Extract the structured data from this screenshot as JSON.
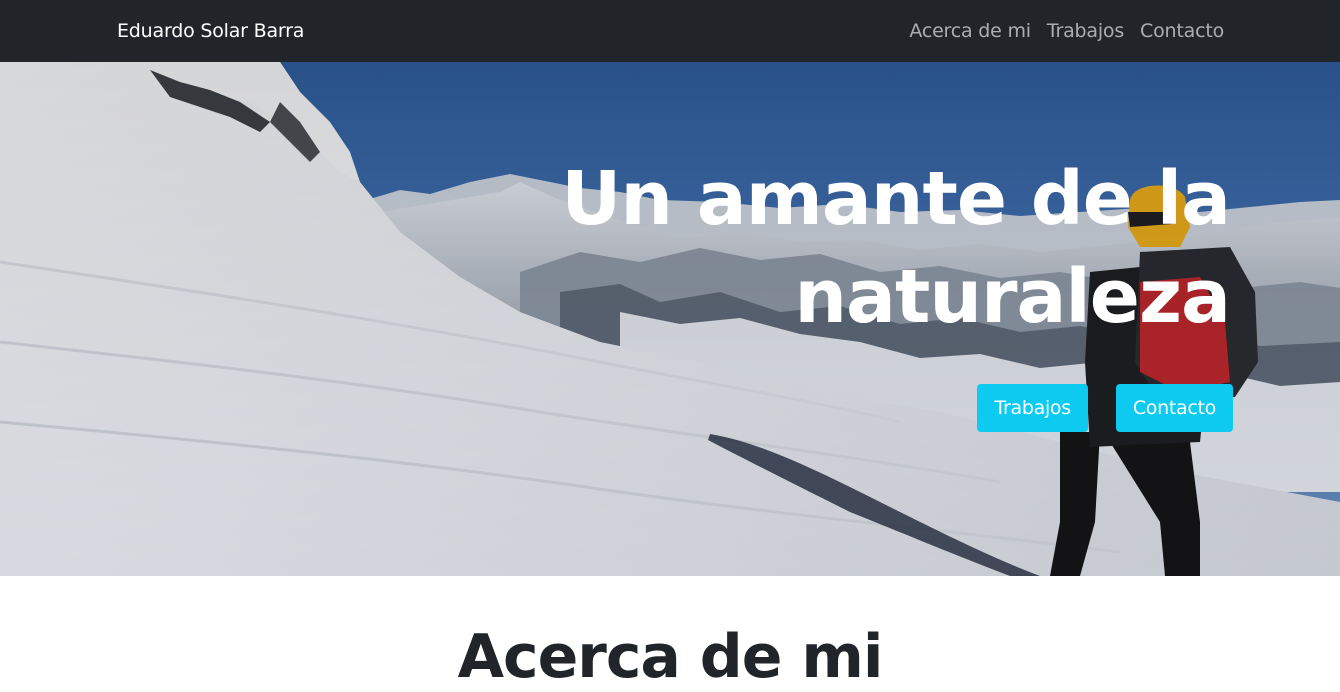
{
  "navbar": {
    "brand": "Eduardo Solar Barra",
    "links": [
      "Acerca de mi",
      "Trabajos",
      "Contacto"
    ]
  },
  "hero": {
    "title": "Un amante de la naturaleza",
    "buttons": [
      "Trabajos",
      "Contacto"
    ]
  },
  "about": {
    "title": "Acerca de mi"
  },
  "colors": {
    "navbar_bg": "#212529",
    "button_bg": "#0dcaf0",
    "sky": "#3f6eb0",
    "snow": "#eef0f4"
  }
}
